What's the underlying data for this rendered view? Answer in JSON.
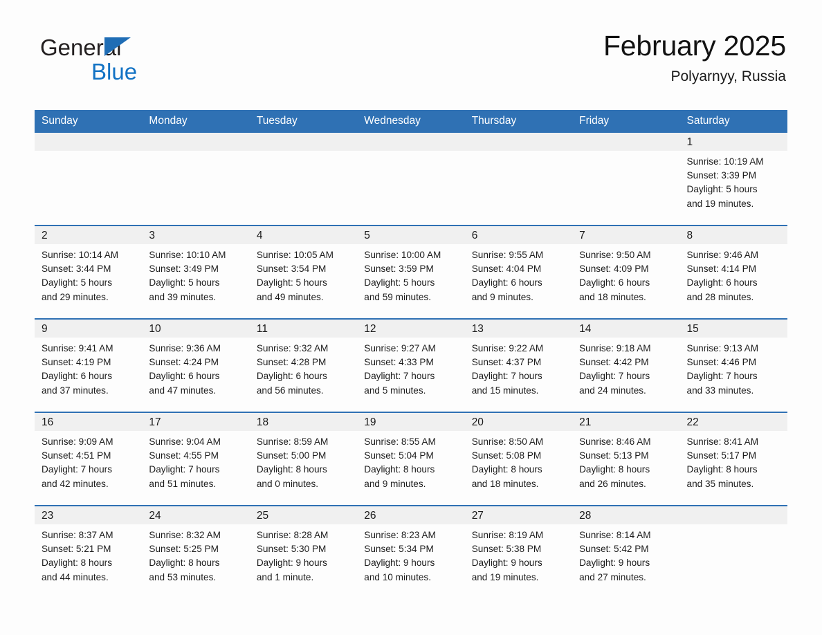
{
  "brand": {
    "line1": "General",
    "line2": "Blue",
    "accent_color": "#1272c4",
    "triangle_color": "#1f6db5"
  },
  "header": {
    "title": "February 2025",
    "subtitle": "Polyarnyy, Russia"
  },
  "calendar": {
    "header_color": "#2f71b4",
    "weekdays": [
      "Sunday",
      "Monday",
      "Tuesday",
      "Wednesday",
      "Thursday",
      "Friday",
      "Saturday"
    ],
    "labels": {
      "sunrise": "Sunrise:",
      "sunset": "Sunset:",
      "daylight": "Daylight:"
    },
    "weeks": [
      [
        {
          "day": "",
          "empty": true
        },
        {
          "day": "",
          "empty": true
        },
        {
          "day": "",
          "empty": true
        },
        {
          "day": "",
          "empty": true
        },
        {
          "day": "",
          "empty": true
        },
        {
          "day": "",
          "empty": true
        },
        {
          "day": "1",
          "sunrise": "Sunrise: 10:19 AM",
          "sunset": "Sunset: 3:39 PM",
          "daylight_1": "Daylight: 5 hours",
          "daylight_2": "and 19 minutes."
        }
      ],
      [
        {
          "day": "2",
          "sunrise": "Sunrise: 10:14 AM",
          "sunset": "Sunset: 3:44 PM",
          "daylight_1": "Daylight: 5 hours",
          "daylight_2": "and 29 minutes."
        },
        {
          "day": "3",
          "sunrise": "Sunrise: 10:10 AM",
          "sunset": "Sunset: 3:49 PM",
          "daylight_1": "Daylight: 5 hours",
          "daylight_2": "and 39 minutes."
        },
        {
          "day": "4",
          "sunrise": "Sunrise: 10:05 AM",
          "sunset": "Sunset: 3:54 PM",
          "daylight_1": "Daylight: 5 hours",
          "daylight_2": "and 49 minutes."
        },
        {
          "day": "5",
          "sunrise": "Sunrise: 10:00 AM",
          "sunset": "Sunset: 3:59 PM",
          "daylight_1": "Daylight: 5 hours",
          "daylight_2": "and 59 minutes."
        },
        {
          "day": "6",
          "sunrise": "Sunrise: 9:55 AM",
          "sunset": "Sunset: 4:04 PM",
          "daylight_1": "Daylight: 6 hours",
          "daylight_2": "and 9 minutes."
        },
        {
          "day": "7",
          "sunrise": "Sunrise: 9:50 AM",
          "sunset": "Sunset: 4:09 PM",
          "daylight_1": "Daylight: 6 hours",
          "daylight_2": "and 18 minutes."
        },
        {
          "day": "8",
          "sunrise": "Sunrise: 9:46 AM",
          "sunset": "Sunset: 4:14 PM",
          "daylight_1": "Daylight: 6 hours",
          "daylight_2": "and 28 minutes."
        }
      ],
      [
        {
          "day": "9",
          "sunrise": "Sunrise: 9:41 AM",
          "sunset": "Sunset: 4:19 PM",
          "daylight_1": "Daylight: 6 hours",
          "daylight_2": "and 37 minutes."
        },
        {
          "day": "10",
          "sunrise": "Sunrise: 9:36 AM",
          "sunset": "Sunset: 4:24 PM",
          "daylight_1": "Daylight: 6 hours",
          "daylight_2": "and 47 minutes."
        },
        {
          "day": "11",
          "sunrise": "Sunrise: 9:32 AM",
          "sunset": "Sunset: 4:28 PM",
          "daylight_1": "Daylight: 6 hours",
          "daylight_2": "and 56 minutes."
        },
        {
          "day": "12",
          "sunrise": "Sunrise: 9:27 AM",
          "sunset": "Sunset: 4:33 PM",
          "daylight_1": "Daylight: 7 hours",
          "daylight_2": "and 5 minutes."
        },
        {
          "day": "13",
          "sunrise": "Sunrise: 9:22 AM",
          "sunset": "Sunset: 4:37 PM",
          "daylight_1": "Daylight: 7 hours",
          "daylight_2": "and 15 minutes."
        },
        {
          "day": "14",
          "sunrise": "Sunrise: 9:18 AM",
          "sunset": "Sunset: 4:42 PM",
          "daylight_1": "Daylight: 7 hours",
          "daylight_2": "and 24 minutes."
        },
        {
          "day": "15",
          "sunrise": "Sunrise: 9:13 AM",
          "sunset": "Sunset: 4:46 PM",
          "daylight_1": "Daylight: 7 hours",
          "daylight_2": "and 33 minutes."
        }
      ],
      [
        {
          "day": "16",
          "sunrise": "Sunrise: 9:09 AM",
          "sunset": "Sunset: 4:51 PM",
          "daylight_1": "Daylight: 7 hours",
          "daylight_2": "and 42 minutes."
        },
        {
          "day": "17",
          "sunrise": "Sunrise: 9:04 AM",
          "sunset": "Sunset: 4:55 PM",
          "daylight_1": "Daylight: 7 hours",
          "daylight_2": "and 51 minutes."
        },
        {
          "day": "18",
          "sunrise": "Sunrise: 8:59 AM",
          "sunset": "Sunset: 5:00 PM",
          "daylight_1": "Daylight: 8 hours",
          "daylight_2": "and 0 minutes."
        },
        {
          "day": "19",
          "sunrise": "Sunrise: 8:55 AM",
          "sunset": "Sunset: 5:04 PM",
          "daylight_1": "Daylight: 8 hours",
          "daylight_2": "and 9 minutes."
        },
        {
          "day": "20",
          "sunrise": "Sunrise: 8:50 AM",
          "sunset": "Sunset: 5:08 PM",
          "daylight_1": "Daylight: 8 hours",
          "daylight_2": "and 18 minutes."
        },
        {
          "day": "21",
          "sunrise": "Sunrise: 8:46 AM",
          "sunset": "Sunset: 5:13 PM",
          "daylight_1": "Daylight: 8 hours",
          "daylight_2": "and 26 minutes."
        },
        {
          "day": "22",
          "sunrise": "Sunrise: 8:41 AM",
          "sunset": "Sunset: 5:17 PM",
          "daylight_1": "Daylight: 8 hours",
          "daylight_2": "and 35 minutes."
        }
      ],
      [
        {
          "day": "23",
          "sunrise": "Sunrise: 8:37 AM",
          "sunset": "Sunset: 5:21 PM",
          "daylight_1": "Daylight: 8 hours",
          "daylight_2": "and 44 minutes."
        },
        {
          "day": "24",
          "sunrise": "Sunrise: 8:32 AM",
          "sunset": "Sunset: 5:25 PM",
          "daylight_1": "Daylight: 8 hours",
          "daylight_2": "and 53 minutes."
        },
        {
          "day": "25",
          "sunrise": "Sunrise: 8:28 AM",
          "sunset": "Sunset: 5:30 PM",
          "daylight_1": "Daylight: 9 hours",
          "daylight_2": "and 1 minute."
        },
        {
          "day": "26",
          "sunrise": "Sunrise: 8:23 AM",
          "sunset": "Sunset: 5:34 PM",
          "daylight_1": "Daylight: 9 hours",
          "daylight_2": "and 10 minutes."
        },
        {
          "day": "27",
          "sunrise": "Sunrise: 8:19 AM",
          "sunset": "Sunset: 5:38 PM",
          "daylight_1": "Daylight: 9 hours",
          "daylight_2": "and 19 minutes."
        },
        {
          "day": "28",
          "sunrise": "Sunrise: 8:14 AM",
          "sunset": "Sunset: 5:42 PM",
          "daylight_1": "Daylight: 9 hours",
          "daylight_2": "and 27 minutes."
        },
        {
          "day": "",
          "empty": true
        }
      ]
    ]
  }
}
